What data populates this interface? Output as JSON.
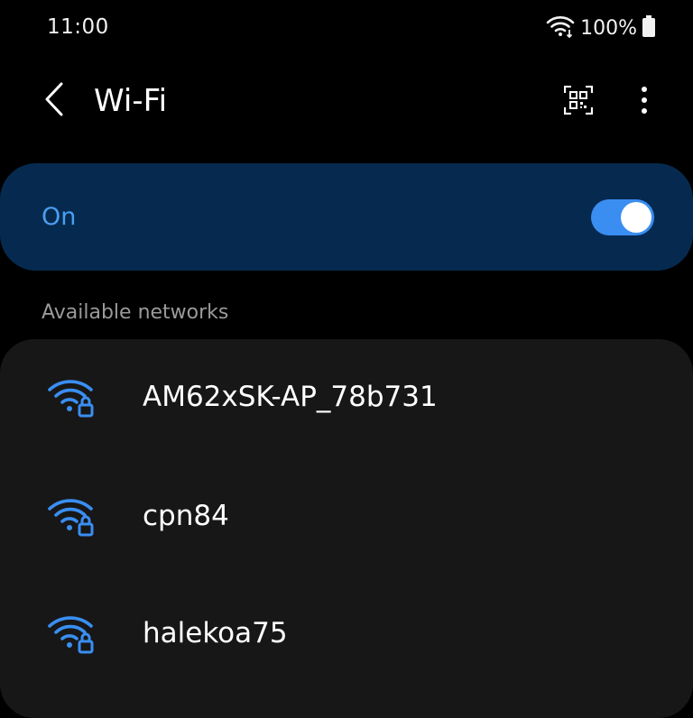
{
  "status_bar": {
    "time": "11:00",
    "battery_percent": "100%",
    "icons": [
      "wifi-calling-icon",
      "battery-icon"
    ]
  },
  "header": {
    "title": "Wi-Fi",
    "back_icon": "back-arrow-icon",
    "qr_icon": "qr-scan-icon",
    "more_icon": "more-vertical-icon"
  },
  "wifi_toggle": {
    "label": "On",
    "enabled": true
  },
  "section": {
    "title": "Available networks"
  },
  "networks": [
    {
      "ssid": "AM62xSK-AP_78b731",
      "secured": true,
      "icon": "wifi-locked-icon"
    },
    {
      "ssid": "cpn84",
      "secured": true,
      "icon": "wifi-locked-icon"
    },
    {
      "ssid": "halekoa75",
      "secured": true,
      "icon": "wifi-locked-icon"
    }
  ],
  "colors": {
    "background": "#000000",
    "toggle_card": "#062a4f",
    "accent": "#3a8ef2",
    "list_card": "#171717",
    "muted_text": "#9a9a9a"
  }
}
